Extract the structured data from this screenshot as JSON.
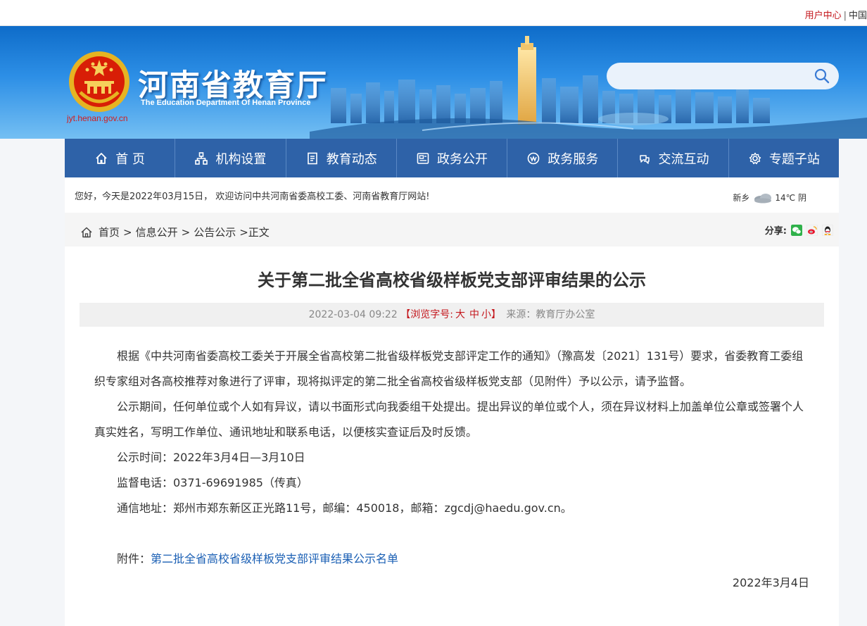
{
  "topbar": {
    "user_center": "用户中心",
    "separator": "|",
    "china": "中国"
  },
  "header": {
    "title": "河南省教育厅",
    "subtitle": "The Education Department Of Henan Province",
    "domain": "jyt.henan.gov.cn",
    "search_value": ""
  },
  "nav": {
    "items": [
      {
        "label": "首 页",
        "icon": "home-icon"
      },
      {
        "label": "机构设置",
        "icon": "org-structure-icon"
      },
      {
        "label": "教育动态",
        "icon": "document-icon"
      },
      {
        "label": "政务公开",
        "icon": "notice-board-icon"
      },
      {
        "label": "政务服务",
        "icon": "service-icon"
      },
      {
        "label": "交流互动",
        "icon": "interaction-icon"
      },
      {
        "label": "专题子站",
        "icon": "settings-gear-icon"
      }
    ]
  },
  "welcome": {
    "text": "您好，今天是2022年03月15日， 欢迎访问中共河南省委高校工委、河南省教育厅网站!",
    "city": "新乡",
    "weather_icon": "cloudy-icon",
    "temperature": "14℃",
    "condition": "阴"
  },
  "breadcrumb": {
    "home": "首页",
    "arrow": ">",
    "level1": "信息公开",
    "level2": "公告公示",
    "current": ">正文"
  },
  "share": {
    "label": "分享:"
  },
  "article": {
    "title": "关于第二批全省高校省级样板党支部评审结果的公示",
    "date": "2022-03-04 09:22",
    "font_size_label": "【浏览字号:",
    "font_large": "大",
    "font_medium": "中",
    "font_small": "小】",
    "source": "来源：教育厅办公室",
    "paragraphs": [
      "根据《中共河南省委高校工委关于开展全省高校第二批省级样板党支部评定工作的通知》（豫高发〔2021〕131号）要求，省委教育工委组织专家组对各高校推荐对象进行了评审，现将拟评定的第二批全省高校省级样板党支部（见附件）予以公示，请予监督。",
      "公示期间，任何单位或个人如有异议，请以书面形式向我委组干处提出。提出异议的单位或个人，须在异议材料上加盖单位公章或签署个人真实姓名，写明工作单位、通讯地址和联系电话，以便核实查证后及时反馈。",
      "公示时间：2022年3月4日—3月10日",
      "监督电话：0371-69691985（传真）",
      "通信地址：郑州市郑东新区正光路11号，邮编：450018，邮箱：zgcdj@haedu.gov.cn。"
    ],
    "attachment_label": "附件：",
    "attachment_link": "第二批全省高校省级样板党支部评审结果公示名单",
    "sign_date": "2022年3月4日"
  }
}
